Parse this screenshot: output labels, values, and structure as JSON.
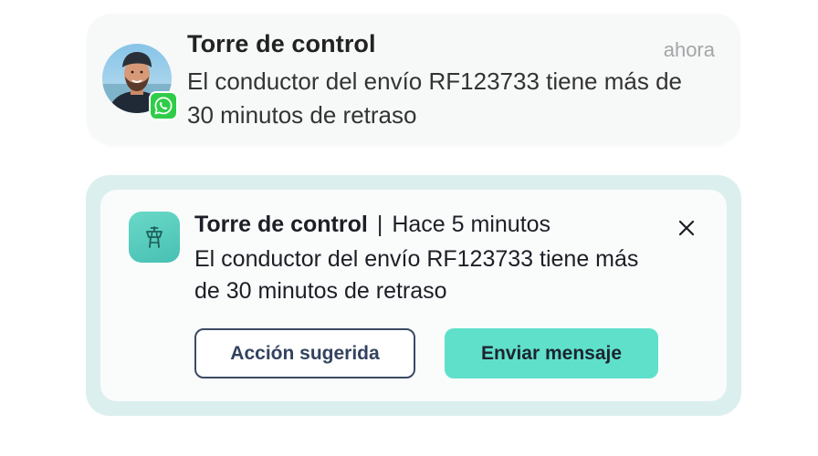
{
  "notification_whatsapp": {
    "title": "Torre de control",
    "time": "ahora",
    "body": "El conductor del envío RF123733 tiene más de 30 minutos de retraso",
    "avatar_icon": "person-avatar",
    "badge_icon": "whatsapp-icon",
    "badge_color": "#2fcc48"
  },
  "notification_app": {
    "title": "Torre de control",
    "separator": "|",
    "time": "Hace 5 minutos",
    "body": "El conductor del envío RF123733 tiene más de 30 minutos de retraso",
    "app_icon": "control-tower-icon",
    "close_icon": "close-icon",
    "buttons": {
      "secondary_label": "Acción sugerida",
      "primary_label": "Enviar mensaje"
    },
    "colors": {
      "accent": "#5fe0cb",
      "card_frame": "#dcefef",
      "secondary_border": "#3a4a66"
    }
  }
}
